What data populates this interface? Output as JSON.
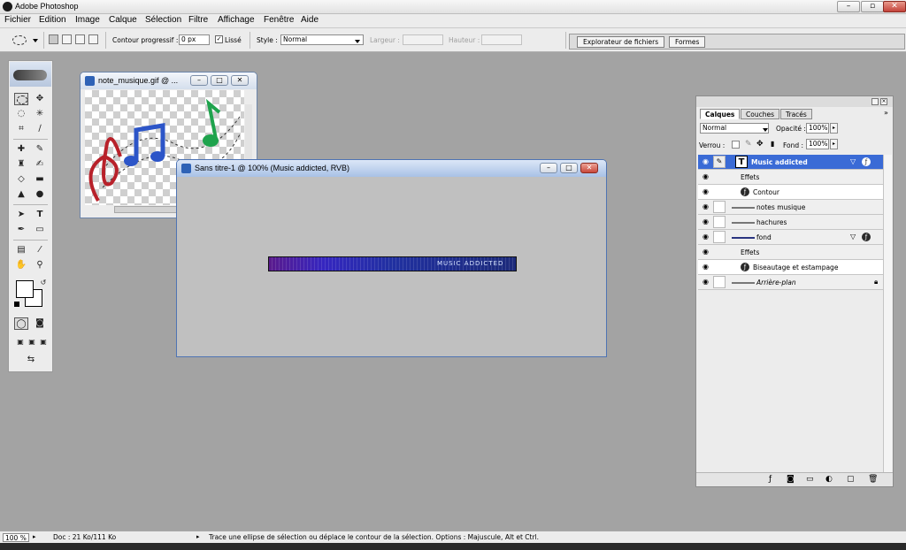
{
  "app": {
    "title": "Adobe Photoshop"
  },
  "menu": [
    "Fichier",
    "Edition",
    "Image",
    "Calque",
    "Sélection",
    "Filtre",
    "Affichage",
    "Fenêtre",
    "Aide"
  ],
  "options": {
    "feather_label": "Contour progressif :",
    "feather_value": "0 px",
    "antialias_label": "Lissé",
    "style_label": "Style :",
    "style_value": "Normal",
    "width_label": "Largeur :",
    "height_label": "Hauteur :"
  },
  "palette_well": {
    "tabs": [
      "Explorateur de fichiers",
      "Formes"
    ]
  },
  "doc1": {
    "title": "note_musique.gif @ ..."
  },
  "doc2": {
    "title": "Sans titre-1 @ 100% (Music addicted, RVB)",
    "banner_text": "MUSIC ADDICTED"
  },
  "layers_panel": {
    "tabs": [
      "Calques",
      "Couches",
      "Tracés"
    ],
    "blend_mode": "Normal",
    "opacity_label": "Opacité :",
    "opacity_value": "100%",
    "lock_label": "Verrou :",
    "fill_label": "Fond :",
    "fill_value": "100%",
    "rows": [
      {
        "name": "Music addicted"
      },
      {
        "name": "Effets"
      },
      {
        "name": "Contour"
      },
      {
        "name": "notes musique"
      },
      {
        "name": "hachures"
      },
      {
        "name": "fond"
      },
      {
        "name": "Effets"
      },
      {
        "name": "Biseautage et estampage"
      },
      {
        "name": "Arrière-plan"
      }
    ]
  },
  "status": {
    "zoom": "100 %",
    "doc_info": "Doc : 21 Ko/111 Ko",
    "hint": "Trace une ellipse de sélection ou déplace le contour de la sélection. Options : Majuscule, Alt et Ctrl."
  },
  "colors": {
    "selected_layer": "#3a6bd6",
    "workspace": "#a3a3a3"
  }
}
